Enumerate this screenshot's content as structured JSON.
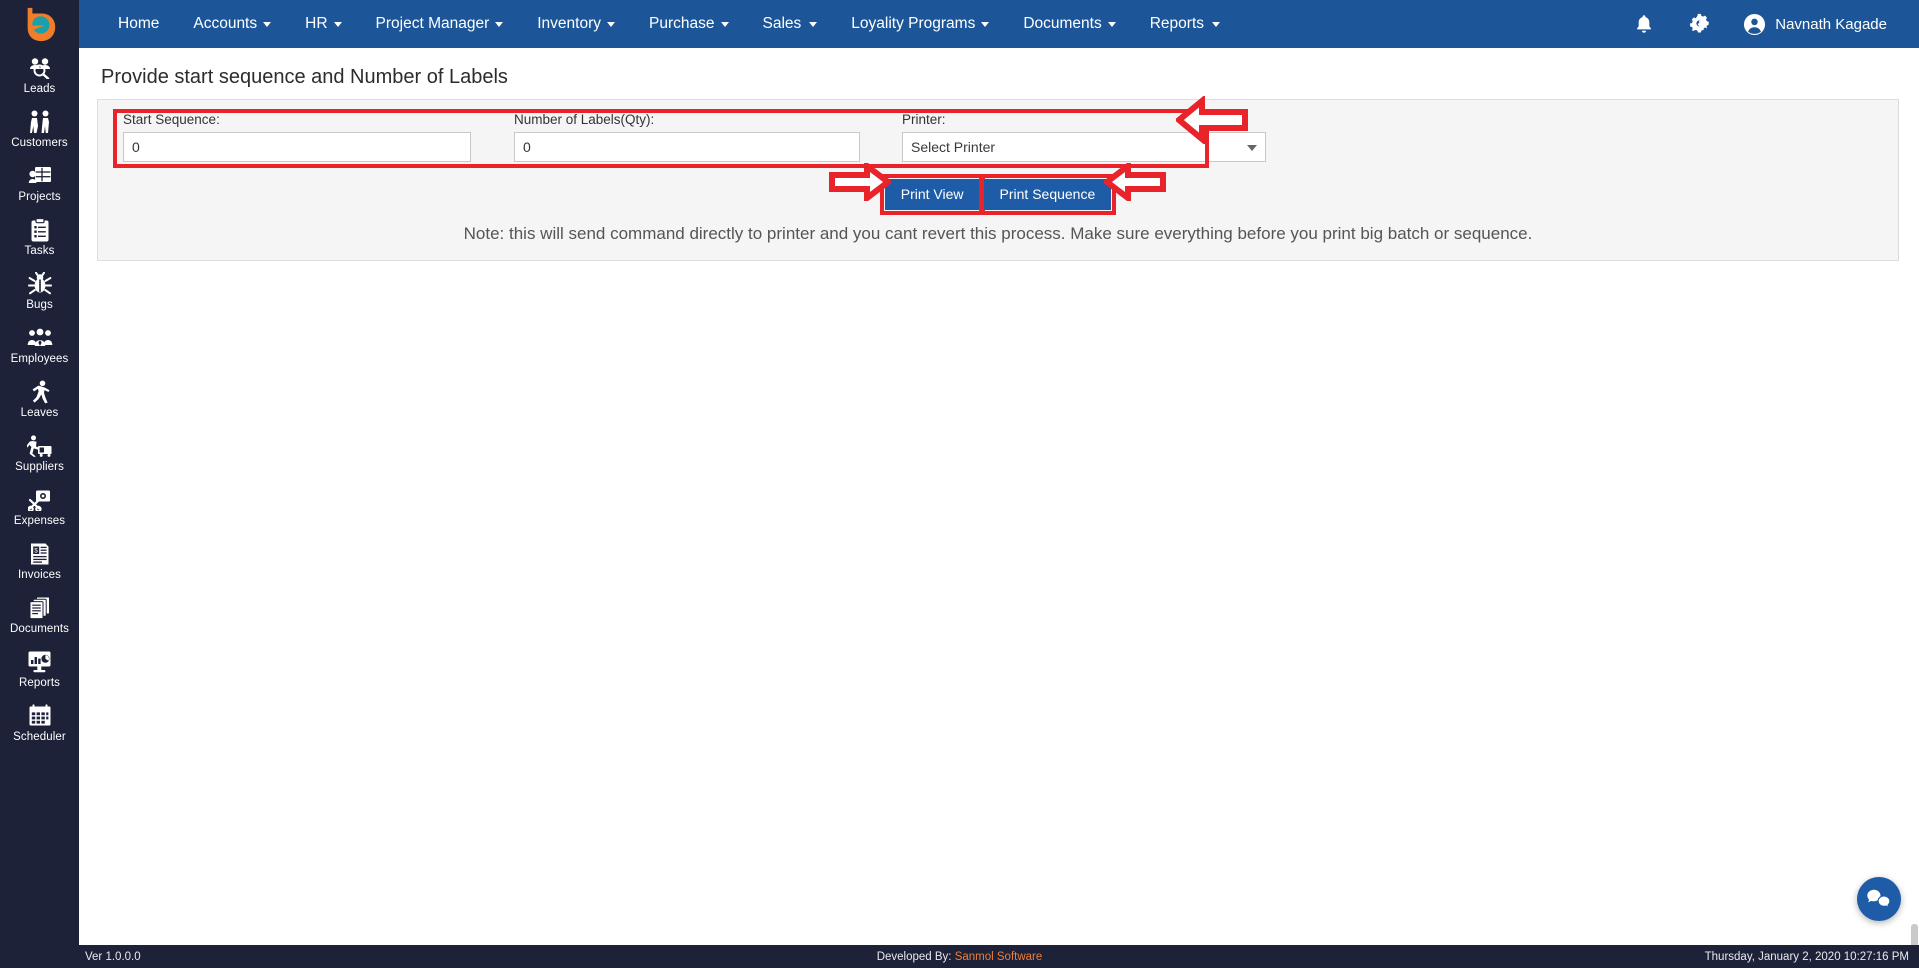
{
  "app": {
    "logo": "bird-logo-icon"
  },
  "topnav": {
    "items": [
      {
        "label": "Home",
        "has_caret": false
      },
      {
        "label": "Accounts",
        "has_caret": true
      },
      {
        "label": "HR",
        "has_caret": true
      },
      {
        "label": "Project Manager",
        "has_caret": true
      },
      {
        "label": "Inventory",
        "has_caret": true
      },
      {
        "label": "Purchase",
        "has_caret": true
      },
      {
        "label": "Sales",
        "has_caret": true
      },
      {
        "label": "Loyality Programs",
        "has_caret": true
      },
      {
        "label": "Documents",
        "has_caret": true
      },
      {
        "label": "Reports",
        "has_caret": true
      }
    ],
    "notifications_icon": "bell-icon",
    "settings_icon": "gears-icon",
    "user": {
      "name": "Navnath Kagade",
      "avatar_icon": "user-circle-icon"
    }
  },
  "sidebar": {
    "items": [
      {
        "label": "Leads",
        "icon": "leads-icon"
      },
      {
        "label": "Customers",
        "icon": "customers-icon"
      },
      {
        "label": "Projects",
        "icon": "projects-icon"
      },
      {
        "label": "Tasks",
        "icon": "tasks-clipboard-icon"
      },
      {
        "label": "Bugs",
        "icon": "bug-icon"
      },
      {
        "label": "Employees",
        "icon": "employees-icon"
      },
      {
        "label": "Leaves",
        "icon": "leaves-walking-icon"
      },
      {
        "label": "Suppliers",
        "icon": "suppliers-icon"
      },
      {
        "label": "Expenses",
        "icon": "expenses-scissors-icon"
      },
      {
        "label": "Invoices",
        "icon": "invoice-icon"
      },
      {
        "label": "Documents",
        "icon": "documents-stack-icon"
      },
      {
        "label": "Reports",
        "icon": "reports-monitor-icon"
      },
      {
        "label": "Scheduler",
        "icon": "calendar-icon"
      }
    ]
  },
  "main": {
    "page_title": "Provide start sequence and Number of Labels",
    "form": {
      "start_sequence": {
        "label": "Start Sequence:",
        "value": "0",
        "placeholder": "0"
      },
      "number_of_labels": {
        "label": "Number of Labels(Qty):",
        "value": "0",
        "placeholder": "0"
      },
      "printer": {
        "label": "Printer:",
        "selected": "Select Printer",
        "options": [
          "Select Printer"
        ],
        "caret_icon": "chevron-down-icon"
      }
    },
    "buttons": {
      "print_view": "Print View",
      "print_sequence": "Print Sequence"
    },
    "note": "Note: this will send command directly to printer and you cant revert this process. Make sure everything before you print big batch or sequence.",
    "annotations": {
      "highlight_color": "#e8232a",
      "arrows": [
        {
          "name": "arrow-pointing-to-printer-field",
          "direction": "left"
        },
        {
          "name": "arrow-pointing-to-print-view-button",
          "direction": "right"
        },
        {
          "name": "arrow-pointing-to-print-sequence-button",
          "direction": "left"
        }
      ]
    }
  },
  "chat": {
    "icon": "chat-bubbles-icon"
  },
  "footer": {
    "version": "Ver 1.0.0.0",
    "developed_by_label": "Developed By:",
    "developed_by_name": "Sanmol Software",
    "timestamp": "Thursday, January 2, 2020 10:27:16 PM"
  },
  "colors": {
    "topbar": "#1c5698",
    "sidebar": "#1d2238",
    "accent_button": "#1f5ca8",
    "highlight_red": "#e8232a",
    "footer_link": "#ef7d3b"
  }
}
